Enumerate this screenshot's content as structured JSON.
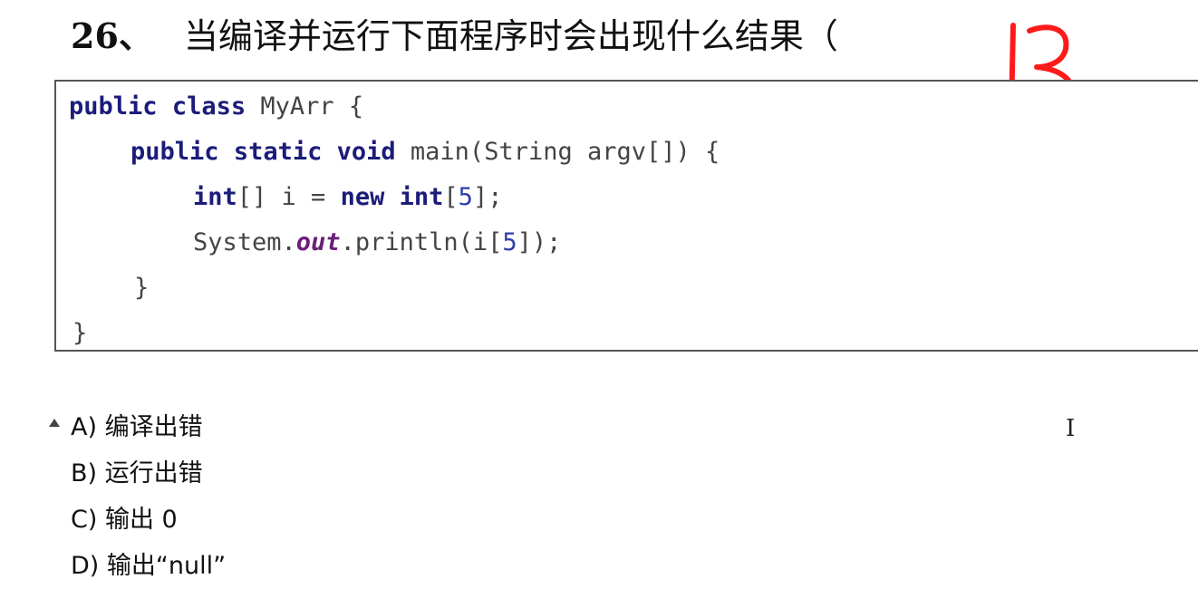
{
  "question": {
    "number": "26、",
    "text": "当编译并运行下面程序时会出现什么结果（",
    "handwritten_answer": "B"
  },
  "code": {
    "line1": {
      "kw1": "public",
      "kw2": "class",
      "rest": " MyArr {"
    },
    "line2": {
      "kw1": "public",
      "kw2": "static",
      "kw3": "void",
      "rest": " main(String argv[]) {"
    },
    "line3": {
      "kw1": "int",
      "mid": "[] i = ",
      "kw2": "new",
      "kw3": "int",
      "open": "[",
      "num": "5",
      "close": "];"
    },
    "line4": {
      "pre": "System.",
      "field": "out",
      "mid": ".println(i[",
      "num": "5",
      "close": "]);"
    },
    "line5": "}",
    "line6": "}"
  },
  "options": [
    {
      "label": "A) 编译出错"
    },
    {
      "label": "B) 运行出错"
    },
    {
      "label": "C) 输出 0"
    },
    {
      "label": "D) 输出“null”"
    }
  ],
  "colors": {
    "keyword": "#1c1c7a",
    "number": "#2b3fa8",
    "field": "#6a1e7a",
    "handwriting": "#ff1a1a"
  },
  "icons": [
    "collapse-triangle-icon",
    "text-cursor-icon"
  ]
}
